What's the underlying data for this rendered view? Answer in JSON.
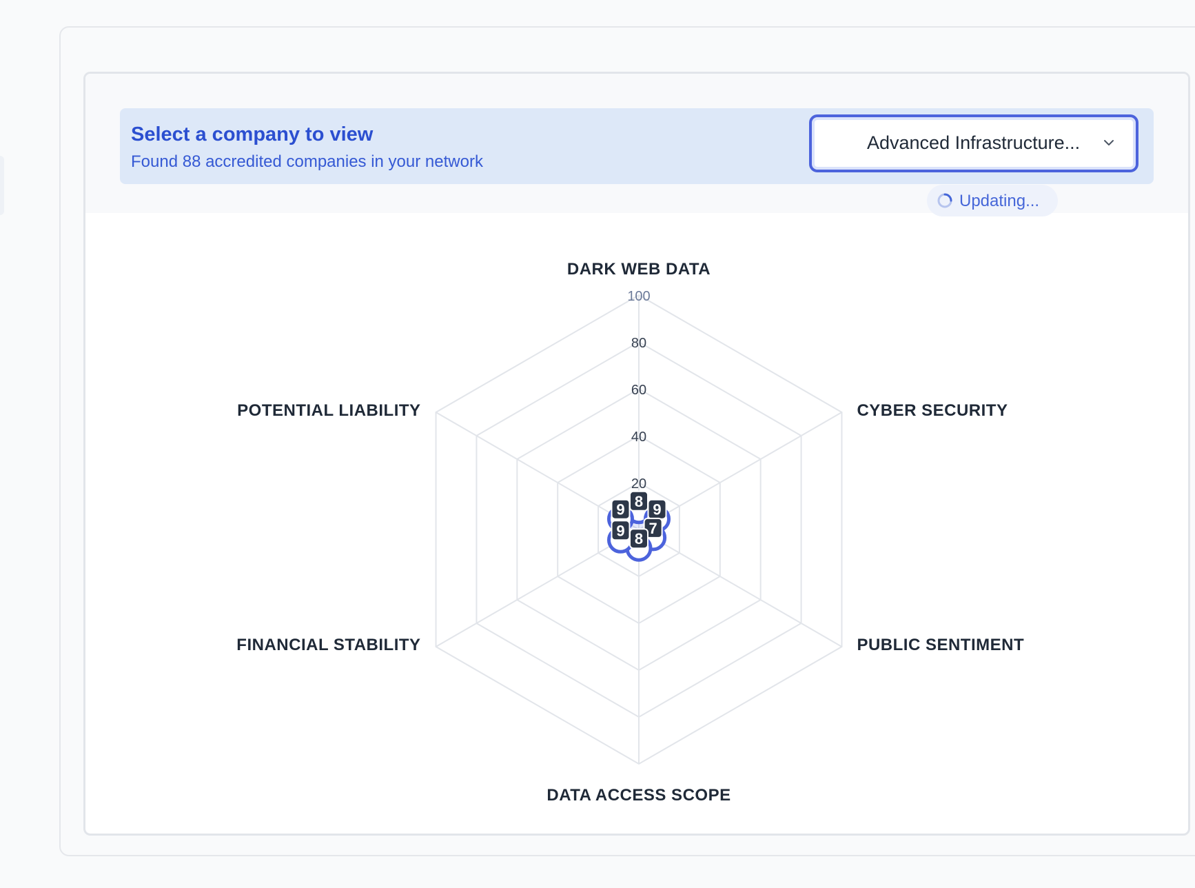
{
  "selector": {
    "title": "Select a company to view",
    "subtitle": "Found 88 accredited companies in your network",
    "selected_company": "Advanced Infrastructure..."
  },
  "status": {
    "text": "Updating...",
    "icon": "spinner-icon"
  },
  "colors": {
    "accent": "#4c63dc",
    "banner_bg": "#dde8f8",
    "grid": "#e2e5ea",
    "label": "#1f2937",
    "marker": "#2d3748"
  },
  "chart_data": {
    "type": "radar",
    "axes": [
      "DARK WEB DATA",
      "CYBER SECURITY",
      "PUBLIC SENTIMENT",
      "DATA ACCESS SCOPE",
      "FINANCIAL STABILITY",
      "POTENTIAL LIABILITY"
    ],
    "ticks": [
      20,
      40,
      60,
      80,
      100
    ],
    "tick_labels": [
      "20",
      "40",
      "60",
      "80",
      "100"
    ],
    "range": [
      0,
      100
    ],
    "grid": true,
    "series": [
      {
        "values": [
          8,
          9,
          7,
          8,
          9,
          9
        ]
      }
    ]
  }
}
